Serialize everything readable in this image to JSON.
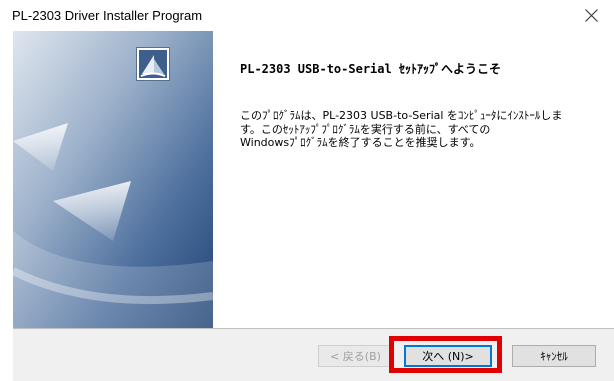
{
  "window": {
    "title": "PL-2303 Driver Installer Program"
  },
  "main": {
    "heading": "PL-2303 USB-to-Serial ｾｯﾄｱｯﾌﾟへようこそ",
    "description_lines": [
      "このﾌﾟﾛｸﾞﾗﾑは、PL-2303 USB-to-Serial をｺﾝﾋﾟｭｰﾀにｲﾝｽﾄｰﾙしま",
      "す。このｾｯﾄｱｯﾌﾟﾌﾟﾛｸﾞﾗﾑを実行する前に、すべての",
      "Windowsﾌﾟﾛｸﾞﾗﾑを終了することを推奨します。"
    ]
  },
  "buttons": {
    "back": "< 戻る(B)",
    "next": "次へ (N)>",
    "cancel": "ｷｬﾝｾﾙ"
  },
  "colors": {
    "panel_light": "#d3dde8",
    "panel_mid": "#6b8bb3",
    "panel_dark": "#2b4f82",
    "highlight": "#e00000"
  },
  "icons": {
    "close": "close-icon",
    "logo": "installshield-logo-icon"
  }
}
